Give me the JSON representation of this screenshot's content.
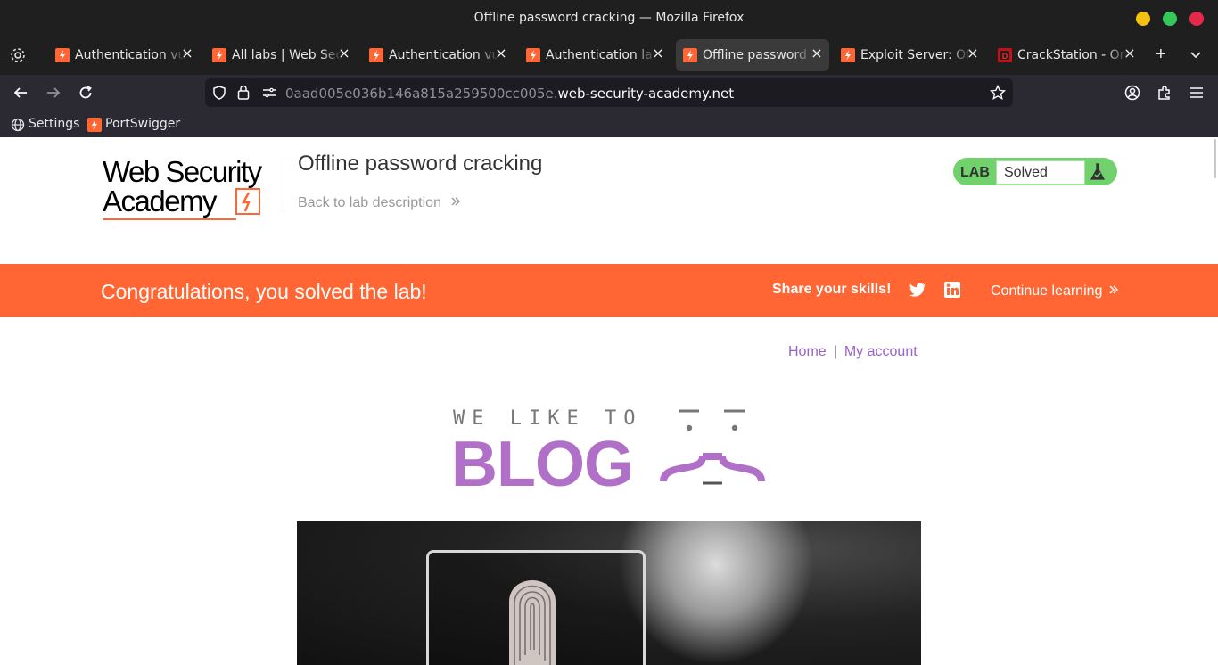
{
  "window": {
    "title": "Offline password cracking — Mozilla Firefox"
  },
  "tabs": [
    {
      "label": "Authentication vulnerabilities",
      "favicon": "portswigger",
      "active": false
    },
    {
      "label": "All labs | Web Security Academy",
      "favicon": "portswigger",
      "active": false
    },
    {
      "label": "Authentication vulnerabilities",
      "favicon": "portswigger",
      "active": false
    },
    {
      "label": "Authentication labs",
      "favicon": "portswigger",
      "active": false
    },
    {
      "label": "Offline password cracking",
      "favicon": "portswigger",
      "active": true
    },
    {
      "label": "Exploit Server: Offline password cracking",
      "favicon": "portswigger",
      "active": false
    },
    {
      "label": "CrackStation - Online Password Hash Cracking",
      "favicon": "crackstation",
      "active": false
    }
  ],
  "url": {
    "subdomain": "0aad005e036b146a815a259500cc005e.",
    "domain": "web-security-academy.net"
  },
  "bookmarks": [
    {
      "label": "Settings",
      "icon": "globe-icon"
    },
    {
      "label": "PortSwigger",
      "icon": "portswigger-icon"
    }
  ],
  "header": {
    "logo_line1": "Web Security",
    "logo_line2": "Academy",
    "lab_title": "Offline password cracking",
    "back_link": "Back to lab description",
    "lab_badge": "LAB",
    "lab_status": "Solved"
  },
  "banner": {
    "message": "Congratulations, you solved the lab!",
    "share_label": "Share your skills!",
    "continue_label": "Continue learning"
  },
  "blog_nav": {
    "home": "Home",
    "separator": "|",
    "account": "My account"
  },
  "blog_logo": {
    "tagline": "WE LIKE TO",
    "word": "BLOG"
  },
  "colors": {
    "accent": "#ff6633",
    "lab_solved": "#70d16d",
    "link": "#9963c8",
    "chrome_bg": "#1f1f1f"
  }
}
